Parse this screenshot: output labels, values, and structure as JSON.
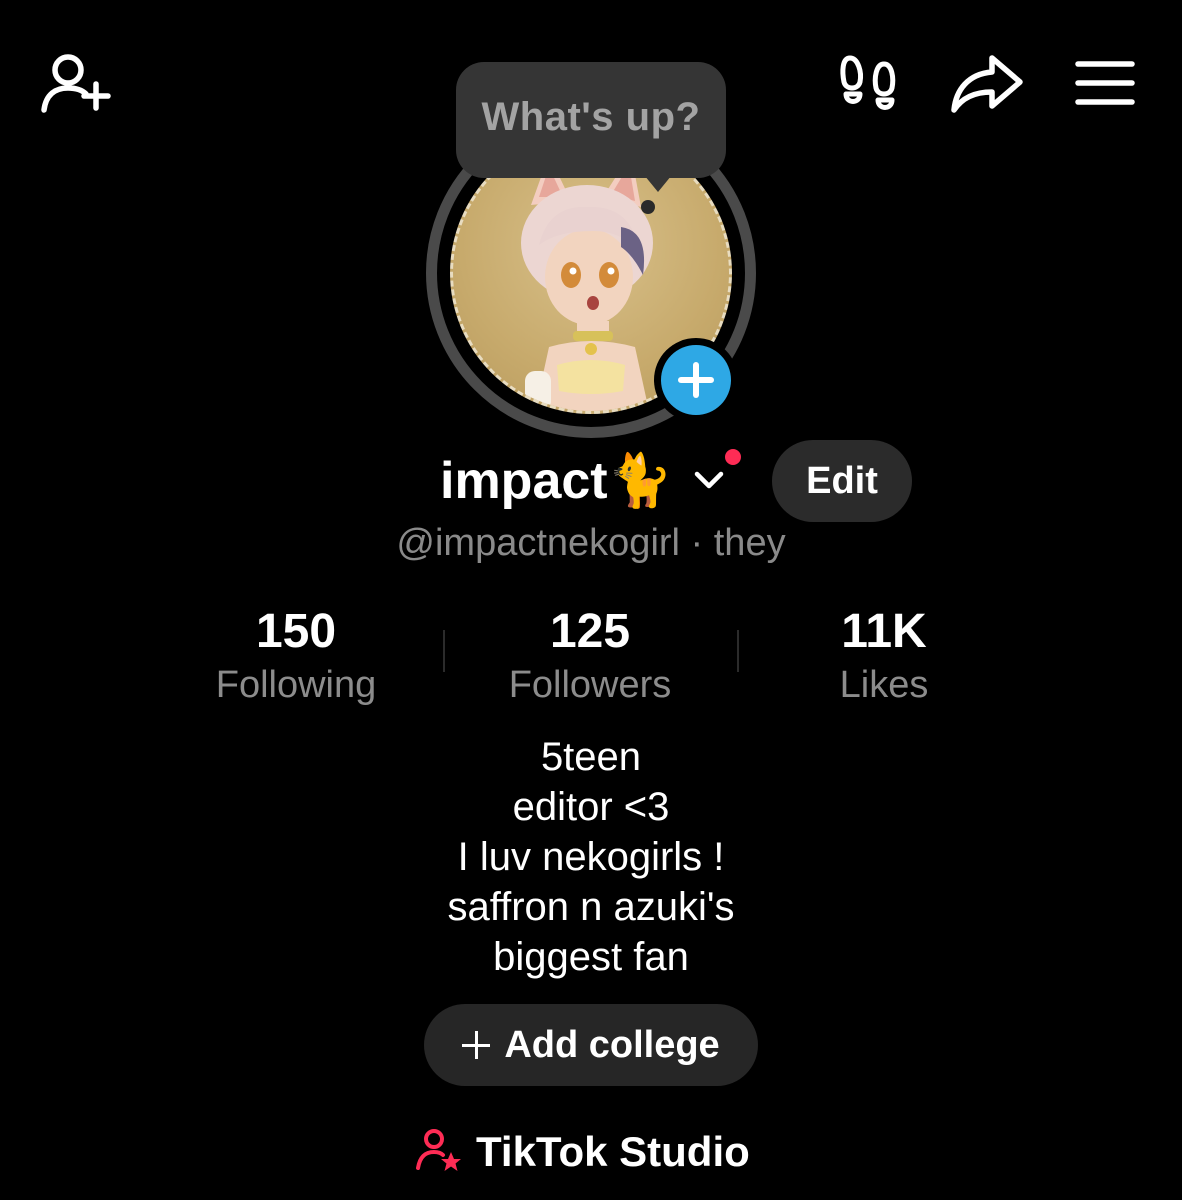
{
  "tooltip": {
    "text": "What's up?"
  },
  "profile": {
    "display_name": "impact🐈",
    "handle_line": "@impactnekogirl · they",
    "edit_label": "Edit"
  },
  "stats": [
    {
      "value": "150",
      "label": "Following"
    },
    {
      "value": "125",
      "label": "Followers"
    },
    {
      "value": "11K",
      "label": "Likes"
    }
  ],
  "bio": {
    "lines": [
      "5teen",
      "editor <3",
      "I luv nekogirls !",
      "saffron n azuki's",
      "biggest fan"
    ]
  },
  "college_button": {
    "label": "Add college"
  },
  "studio": {
    "label": "TikTok Studio"
  },
  "icons": {
    "top_left": "add-friend-icon",
    "top_right": [
      "footprints-icon",
      "share-icon",
      "menu-icon"
    ],
    "studio": "person-star-icon"
  },
  "colors": {
    "background": "#000000",
    "accent_blue": "#2ea8e5",
    "notification_red": "#fe2c55",
    "button_bg": "#2b2b2b"
  }
}
